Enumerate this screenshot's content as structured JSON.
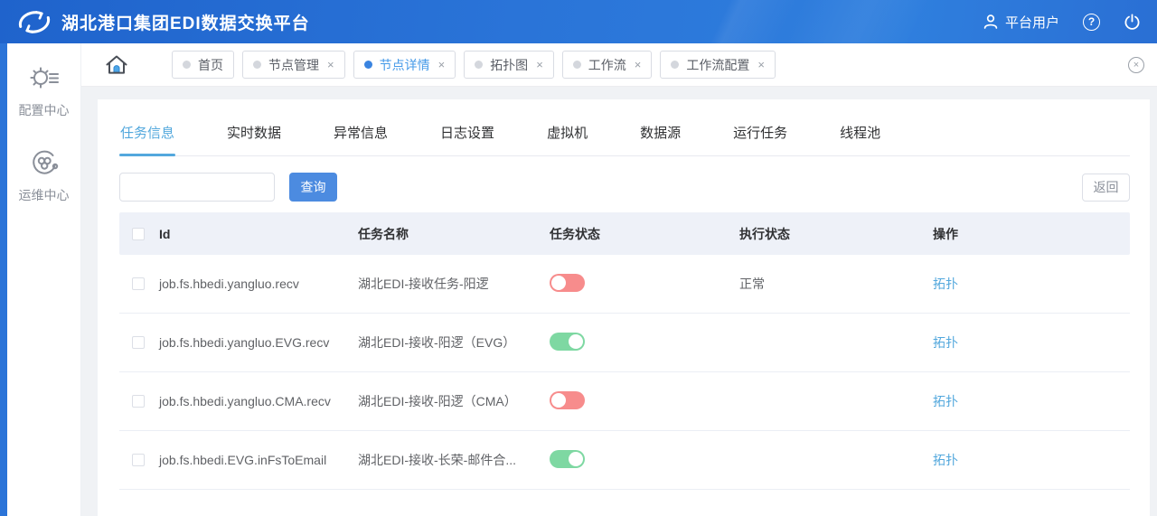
{
  "header": {
    "title": "湖北港口集团EDI数据交换平台",
    "user_label": "平台用户",
    "help_glyph": "?"
  },
  "sidebar": {
    "items": [
      {
        "label": "配置中心",
        "icon": "gear-settings-icon"
      },
      {
        "label": "运维中心",
        "icon": "ops-cycle-icon"
      }
    ]
  },
  "tabbar": {
    "tabs": [
      {
        "label": "首页",
        "active": false,
        "closable": false
      },
      {
        "label": "节点管理",
        "active": false,
        "closable": true
      },
      {
        "label": "节点详情",
        "active": true,
        "closable": true
      },
      {
        "label": "拓扑图",
        "active": false,
        "closable": true
      },
      {
        "label": "工作流",
        "active": false,
        "closable": true
      },
      {
        "label": "工作流配置",
        "active": false,
        "closable": true
      }
    ],
    "close_glyph": "×"
  },
  "content": {
    "tabs": [
      {
        "label": "任务信息",
        "active": true
      },
      {
        "label": "实时数据",
        "active": false
      },
      {
        "label": "异常信息",
        "active": false
      },
      {
        "label": "日志设置",
        "active": false
      },
      {
        "label": "虚拟机",
        "active": false
      },
      {
        "label": "数据源",
        "active": false
      },
      {
        "label": "运行任务",
        "active": false
      },
      {
        "label": "线程池",
        "active": false
      }
    ],
    "search": {
      "value": "",
      "placeholder": ""
    },
    "query_label": "查询",
    "back_label": "返回"
  },
  "table": {
    "columns": {
      "id": "Id",
      "name": "任务名称",
      "task_state": "任务状态",
      "exec_status": "执行状态",
      "action": "操作"
    },
    "rows": [
      {
        "id": "job.fs.hbedi.yangluo.recv",
        "name": "湖北EDI-接收任务-阳逻",
        "task_state": "off",
        "exec_status": "正常",
        "action": "拓扑"
      },
      {
        "id": "job.fs.hbedi.yangluo.EVG.recv",
        "name": "湖北EDI-接收-阳逻（EVG）",
        "task_state": "on",
        "exec_status": "",
        "action": "拓扑"
      },
      {
        "id": "job.fs.hbedi.yangluo.CMA.recv",
        "name": "湖北EDI-接收-阳逻（CMA）",
        "task_state": "off",
        "exec_status": "",
        "action": "拓扑"
      },
      {
        "id": "job.fs.hbedi.EVG.inFsToEmail",
        "name": "湖北EDI-接收-长荣-邮件合...",
        "task_state": "on",
        "exec_status": "",
        "action": "拓扑"
      }
    ]
  },
  "colors": {
    "header_blue": "#2b74d8",
    "accent_blue": "#53a8dd",
    "query_button_blue": "#4c8be0",
    "toggle_on_green": "#7ed8a2",
    "toggle_off_red": "#f78c8c",
    "table_header_bg": "#eef1f8"
  }
}
